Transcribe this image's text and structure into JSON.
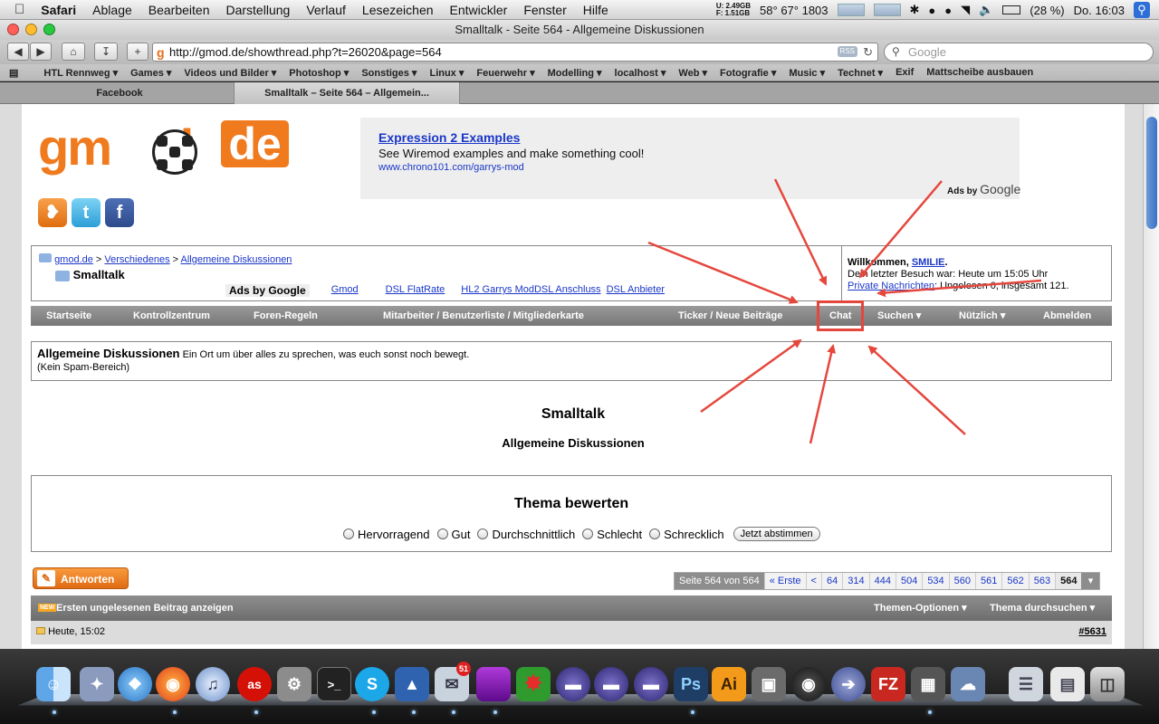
{
  "menubar": {
    "apple": "",
    "app": "Safari",
    "items": [
      "Ablage",
      "Bearbeiten",
      "Darstellung",
      "Verlauf",
      "Lesezeichen",
      "Entwickler",
      "Fenster",
      "Hilfe"
    ],
    "mem_u": "U: 2.49GB",
    "mem_f": "F: 1.51GB",
    "temps": "58° 67° 1803",
    "battery": "(28 %)",
    "clock": "Do. 16:03"
  },
  "window": {
    "title": "Smalltalk - Seite 564 - Allgemeine Diskussionen"
  },
  "toolbar": {
    "url": "http://gmod.de/showthread.php?t=26020&page=564",
    "rss": "RSS",
    "search_placeholder": "Google"
  },
  "bookmarks": [
    "HTL Rennweg ▾",
    "Games ▾",
    "Videos und Bilder ▾",
    "Photoshop ▾",
    "Sonstiges ▾",
    "Linux ▾",
    "Feuerwehr ▾",
    "Modelling ▾",
    "localhost ▾",
    "Web ▾",
    "Fotografie ▾",
    "Music ▾",
    "Technet ▾",
    "Exif",
    "Mattscheibe ausbauen"
  ],
  "tabs": [
    {
      "label": "Facebook",
      "active": false
    },
    {
      "label": "Smalltalk – Seite 564 – Allgemein...",
      "active": true
    }
  ],
  "page": {
    "logo_text": "gm",
    "logo_text2": "d",
    "logo_de": "de",
    "ad": {
      "title": "Expression 2 Examples",
      "desc": "See Wiremod examples and make something cool!",
      "url": "www.chrono101.com/garrys-mod",
      "ads_by": "Ads by",
      "ads_google": "Google"
    },
    "breadcrumb": {
      "c1": "gmod.de",
      "sep": " > ",
      "c2": "Verschiedenes",
      "c3": "Allgemeine Diskussionen",
      "current": "Smalltalk"
    },
    "adlinks": {
      "heading": "Ads by Google",
      "links": [
        "Gmod",
        "DSL FlatRate",
        "HL2 Garrys Mod",
        "DSL Anschluss",
        "DSL Anbieter"
      ]
    },
    "welcome": {
      "greeting": "Willkommen,",
      "user": "SMILIE",
      "last_visit": "Dein letzter Besuch war: Heute um 15:05 Uhr",
      "pm_link": "Private Nachrichten",
      "pm_rest": ": Ungelesen 0, insgesamt 121."
    },
    "nav": [
      "Startseite",
      "Kontrollzentrum",
      "Foren-Regeln",
      "Mitarbeiter / Benutzerliste / Mitgliederkarte",
      "Ticker / Neue Beiträge",
      "Chat",
      "Suchen ▾",
      "Nützlich ▾",
      "Abmelden"
    ],
    "forum": {
      "name": "Allgemeine Diskussionen",
      "desc": "Ein Ort um über alles zu sprechen, was euch sonst noch bewegt.",
      "note": "(Kein Spam-Bereich)"
    },
    "thread_title": "Smalltalk",
    "thread_sub": "Allgemeine Diskussionen",
    "rating": {
      "title": "Thema bewerten",
      "options": [
        "Hervorragend",
        "Gut",
        "Durchschnittlich",
        "Schlecht",
        "Schrecklich"
      ],
      "vote": "Jetzt abstimmen"
    },
    "reply": "Antworten",
    "pager": {
      "label": "Seite 564 von 564",
      "first": "« Erste",
      "prev": "<",
      "pages": [
        "64",
        "314",
        "444",
        "504",
        "534",
        "560",
        "561",
        "562",
        "563"
      ],
      "current": "564"
    },
    "threadbar": {
      "new_badge": "NEW",
      "first_unread": "Ersten ungelesenen Beitrag anzeigen",
      "options": "Themen-Optionen ▾",
      "search": "Thema durchsuchen ▾"
    },
    "post": {
      "time": "Heute, 15:02",
      "number": "#5631"
    }
  },
  "colors": {
    "brand": "#f07a1e",
    "link": "#1a37c8",
    "highlight": "#e5473d"
  }
}
